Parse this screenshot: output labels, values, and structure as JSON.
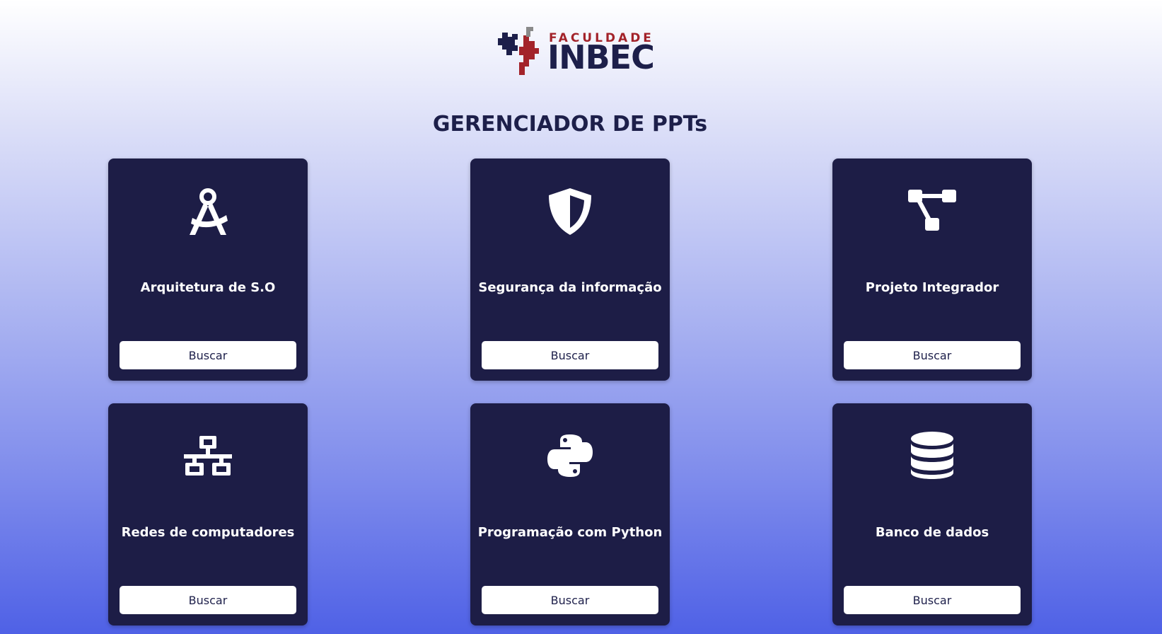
{
  "header": {
    "logo_top": "FACULDADE",
    "logo_main": "INBEC",
    "title": "GERENCIADOR DE PPTs"
  },
  "colors": {
    "card_bg": "#1d1d46",
    "logo_red": "#a3232a",
    "logo_navy": "#1d1f4a",
    "gradient_bottom": "#4f61e6"
  },
  "cards": [
    {
      "title": "Arquitetura de S.O",
      "icon": "compass-drafting-icon",
      "button": "Buscar"
    },
    {
      "title": "Segurança da informação",
      "icon": "shield-icon",
      "button": "Buscar"
    },
    {
      "title": "Projeto Integrador",
      "icon": "diagram-project-icon",
      "button": "Buscar"
    },
    {
      "title": "Redes de computadores",
      "icon": "network-wired-icon",
      "button": "Buscar"
    },
    {
      "title": "Programação com Python",
      "icon": "python-icon",
      "button": "Buscar"
    },
    {
      "title": "Banco de dados",
      "icon": "database-icon",
      "button": "Buscar"
    }
  ]
}
